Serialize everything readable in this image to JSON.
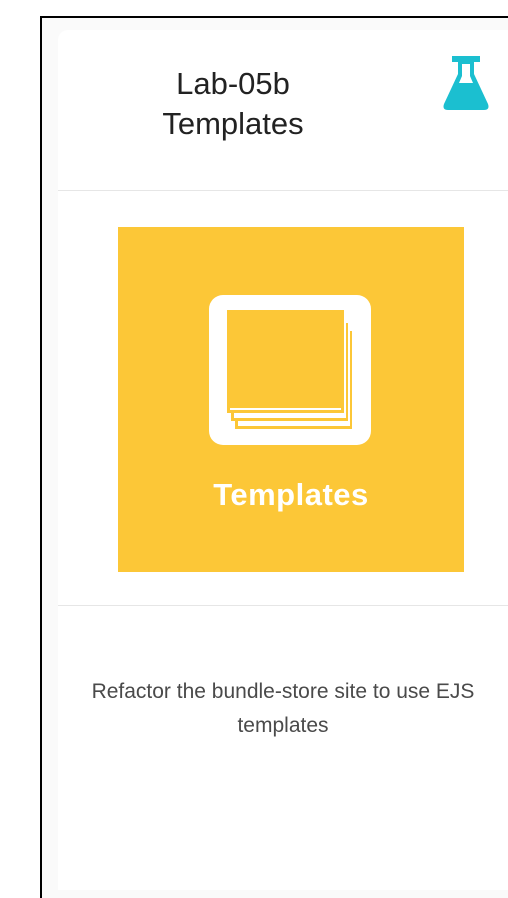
{
  "card": {
    "title_line1": "Lab-05b",
    "title_line2": "Templates",
    "tile_label": "Templates",
    "description": "Refactor the bundle-store site to use EJS templates"
  },
  "icons": {
    "header_icon": "flask-icon",
    "tile_icon": "templates-icon"
  },
  "colors": {
    "flask_icon": "#1bbfd0",
    "tile_background": "#fcc737",
    "tile_foreground": "#ffffff"
  }
}
